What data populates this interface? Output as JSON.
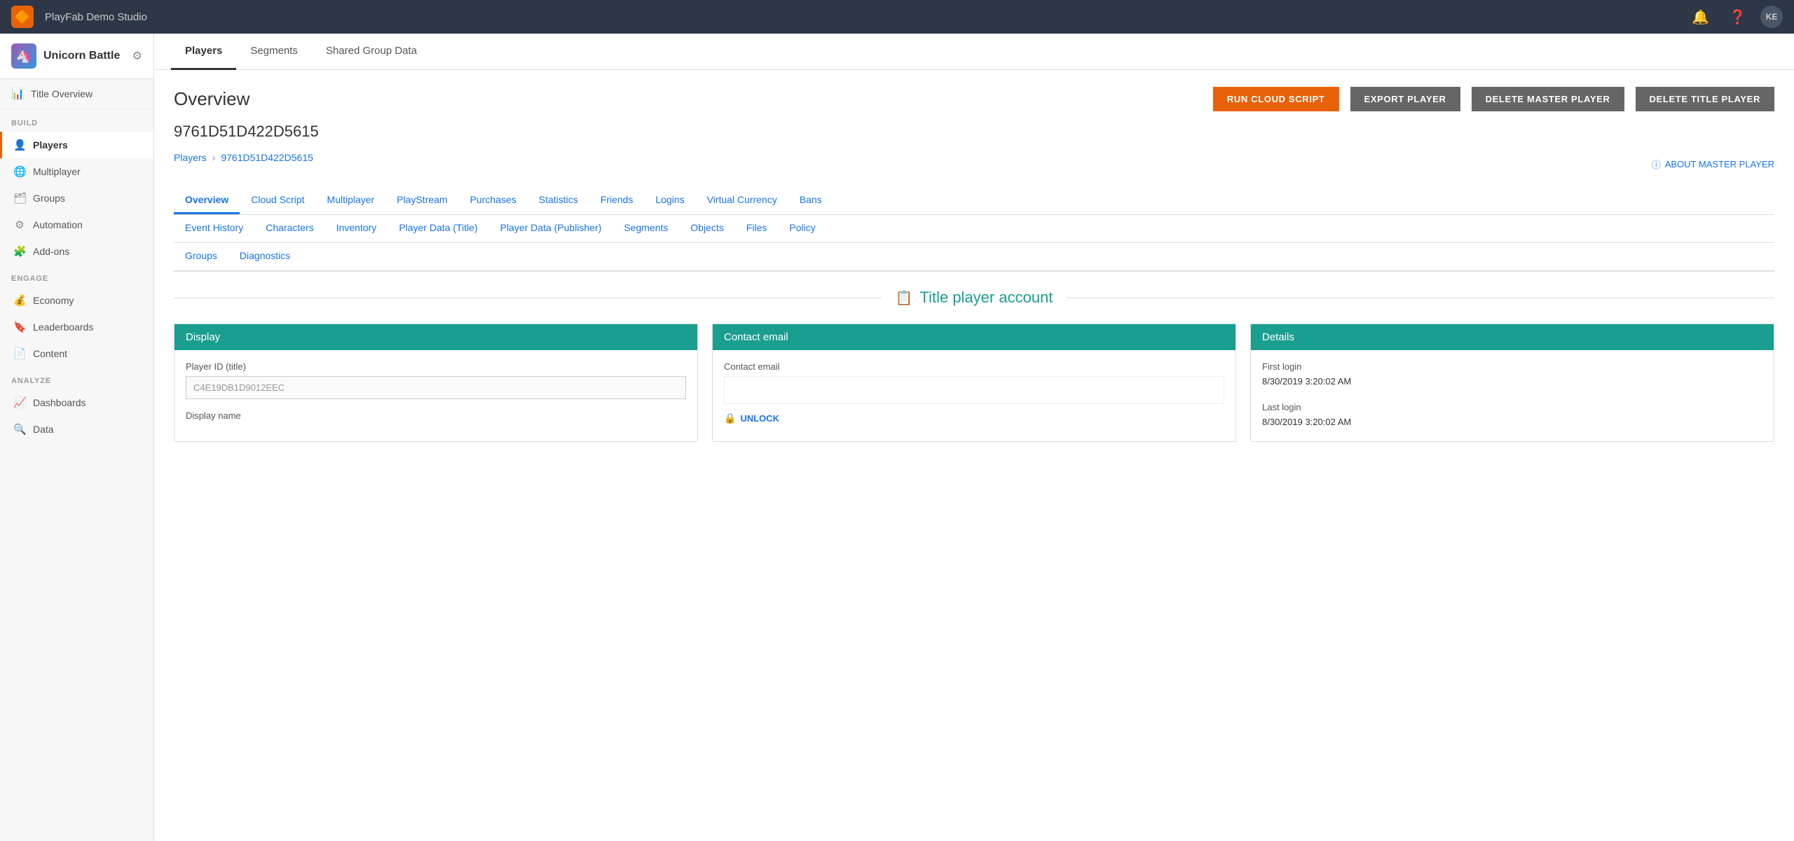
{
  "topbar": {
    "logo_symbol": "🔶",
    "title": "PlayFab Demo Studio",
    "avatar_initials": "KE"
  },
  "sidebar": {
    "game_name": "Unicorn Battle",
    "sections": [
      {
        "label": "",
        "items": [
          {
            "id": "title-overview",
            "label": "Title Overview",
            "icon": "📊",
            "active": false
          }
        ]
      },
      {
        "label": "BUILD",
        "items": [
          {
            "id": "players",
            "label": "Players",
            "icon": "👤",
            "active": true
          },
          {
            "id": "multiplayer",
            "label": "Multiplayer",
            "icon": "🌐",
            "active": false
          },
          {
            "id": "groups",
            "label": "Groups",
            "icon": "🗂",
            "active": false
          },
          {
            "id": "automation",
            "label": "Automation",
            "icon": "⚙",
            "active": false
          },
          {
            "id": "add-ons",
            "label": "Add-ons",
            "icon": "🧩",
            "active": false
          }
        ]
      },
      {
        "label": "ENGAGE",
        "items": [
          {
            "id": "economy",
            "label": "Economy",
            "icon": "💰",
            "active": false
          },
          {
            "id": "leaderboards",
            "label": "Leaderboards",
            "icon": "🔖",
            "active": false
          },
          {
            "id": "content",
            "label": "Content",
            "icon": "📄",
            "active": false
          }
        ]
      },
      {
        "label": "ANALYZE",
        "items": [
          {
            "id": "dashboards",
            "label": "Dashboards",
            "icon": "📈",
            "active": false
          },
          {
            "id": "data",
            "label": "Data",
            "icon": "🔍",
            "active": false
          }
        ]
      }
    ]
  },
  "sub_tabs": [
    {
      "id": "players",
      "label": "Players",
      "active": true
    },
    {
      "id": "segments",
      "label": "Segments",
      "active": false
    },
    {
      "id": "shared-group-data",
      "label": "Shared Group Data",
      "active": false
    }
  ],
  "overview": {
    "title": "Overview",
    "player_id": "9761D51D422D5615",
    "buttons": {
      "run_cloud_script": "RUN CLOUD SCRIPT",
      "export_player": "EXPORT PLAYER",
      "delete_master_player": "DELETE MASTER PLAYER",
      "delete_title_player": "DELETE TITLE PLAYER"
    },
    "breadcrumb": {
      "parent": "Players",
      "current": "9761D51D422D5615"
    },
    "about_master": "ABOUT MASTER PLAYER"
  },
  "nav_tabs_row1": [
    {
      "id": "overview-tab",
      "label": "Overview",
      "active": true
    },
    {
      "id": "cloud-script-tab",
      "label": "Cloud Script",
      "active": false
    },
    {
      "id": "multiplayer-tab",
      "label": "Multiplayer",
      "active": false
    },
    {
      "id": "playstream-tab",
      "label": "PlayStream",
      "active": false
    },
    {
      "id": "purchases-tab",
      "label": "Purchases",
      "active": false
    },
    {
      "id": "statistics-tab",
      "label": "Statistics",
      "active": false
    },
    {
      "id": "friends-tab",
      "label": "Friends",
      "active": false
    },
    {
      "id": "logins-tab",
      "label": "Logins",
      "active": false
    },
    {
      "id": "virtual-currency-tab",
      "label": "Virtual Currency",
      "active": false
    },
    {
      "id": "bans-tab",
      "label": "Bans",
      "active": false
    }
  ],
  "nav_tabs_row2": [
    {
      "id": "event-history-tab",
      "label": "Event History",
      "active": false
    },
    {
      "id": "characters-tab",
      "label": "Characters",
      "active": false
    },
    {
      "id": "inventory-tab",
      "label": "Inventory",
      "active": false
    },
    {
      "id": "player-data-title-tab",
      "label": "Player Data (Title)",
      "active": false
    },
    {
      "id": "player-data-publisher-tab",
      "label": "Player Data (Publisher)",
      "active": false
    },
    {
      "id": "segments-tab2",
      "label": "Segments",
      "active": false
    },
    {
      "id": "objects-tab",
      "label": "Objects",
      "active": false
    },
    {
      "id": "files-tab",
      "label": "Files",
      "active": false
    },
    {
      "id": "policy-tab",
      "label": "Policy",
      "active": false
    }
  ],
  "nav_tabs_row3": [
    {
      "id": "groups-tab2",
      "label": "Groups",
      "active": false
    },
    {
      "id": "diagnostics-tab",
      "label": "Diagnostics",
      "active": false
    }
  ],
  "player_section": {
    "title": "Title player account",
    "cards": [
      {
        "id": "display",
        "header": "Display",
        "fields": [
          {
            "label": "Player ID (title)",
            "type": "input",
            "value": "C4E19DB1D9012EEC"
          },
          {
            "label": "Display name",
            "type": "text",
            "value": ""
          }
        ]
      },
      {
        "id": "contact-email",
        "header": "Contact email",
        "fields": [
          {
            "label": "Contact email",
            "type": "text",
            "value": ""
          }
        ],
        "unlock_label": "UNLOCK"
      },
      {
        "id": "details",
        "header": "Details",
        "fields": [
          {
            "label": "First login",
            "value": "8/30/2019 3:20:02 AM"
          },
          {
            "label": "Last login",
            "value": "8/30/2019 3:20:02 AM"
          }
        ]
      }
    ]
  }
}
